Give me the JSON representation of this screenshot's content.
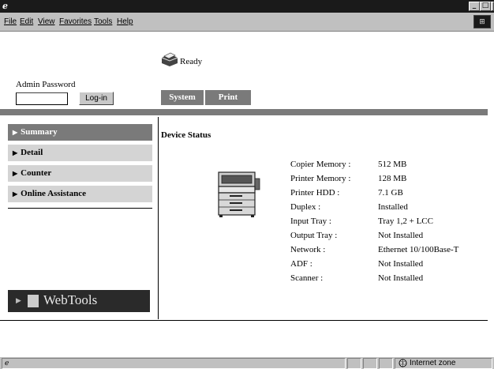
{
  "menu": {
    "items": [
      "File",
      "Edit",
      "View",
      "Favorites",
      "Tools",
      "Help"
    ]
  },
  "status": {
    "text": "Ready"
  },
  "admin": {
    "label": "Admin Password",
    "password_value": "",
    "login_label": "Log-in"
  },
  "top_tabs": [
    "System",
    "Print"
  ],
  "sidebar": {
    "items": [
      "Summary",
      "Detail",
      "Counter",
      "Online Assistance"
    ],
    "active": "Summary",
    "webtools_label": "WebTools"
  },
  "device": {
    "title": "Device Status",
    "specs": [
      {
        "label": "Copier Memory :",
        "value": "512 MB"
      },
      {
        "label": "Printer Memory :",
        "value": "128 MB"
      },
      {
        "label": "Printer HDD :",
        "value": "7.1 GB"
      },
      {
        "label": "Duplex :",
        "value": "Installed"
      },
      {
        "label": "Input Tray :",
        "value": "Tray 1,2 + LCC"
      },
      {
        "label": "Output Tray :",
        "value": "Not Installed"
      },
      {
        "label": "Network :",
        "value": "Ethernet 10/100Base-T"
      },
      {
        "label": "ADF :",
        "value": "Not Installed"
      },
      {
        "label": "Scanner :",
        "value": "Not Installed"
      }
    ]
  },
  "statusbar": {
    "zone": "Internet zone"
  }
}
